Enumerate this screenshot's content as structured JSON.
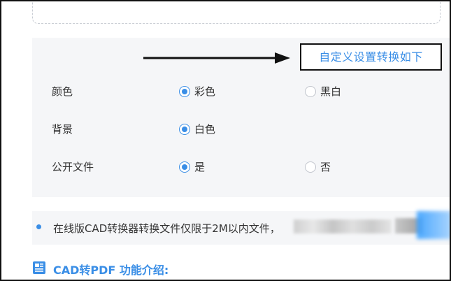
{
  "heading": "自定义设置转换如下",
  "colors": {
    "accent": "#3a8ee6",
    "panel_bg": "#f5f6f8",
    "text": "#333333",
    "radio_border": "#c0c4cc"
  },
  "settings": {
    "color": {
      "label": "颜色",
      "options": [
        {
          "label": "彩色",
          "checked": true
        },
        {
          "label": "黑白",
          "checked": false
        }
      ]
    },
    "background": {
      "label": "背景",
      "options": [
        {
          "label": "白色",
          "checked": true
        }
      ]
    },
    "public_file": {
      "label": "公开文件",
      "options": [
        {
          "label": "是",
          "checked": true
        },
        {
          "label": "否",
          "checked": false
        }
      ]
    }
  },
  "notice": {
    "text": "在线版CAD转换器转换文件仅限于2M以内文件，"
  },
  "section": {
    "title": "CAD转PDF 功能介绍:",
    "icon": "document-icon"
  }
}
